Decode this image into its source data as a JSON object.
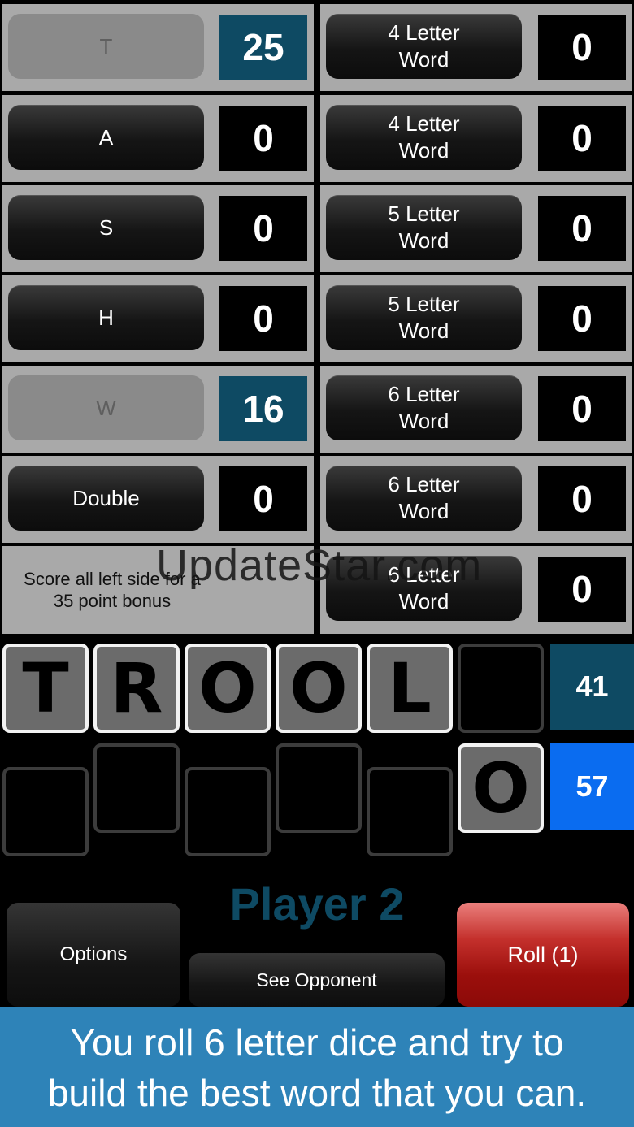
{
  "left_rows": [
    {
      "label": "T",
      "score": "25",
      "used": true
    },
    {
      "label": "A",
      "score": "0",
      "used": false
    },
    {
      "label": "S",
      "score": "0",
      "used": false
    },
    {
      "label": "H",
      "score": "0",
      "used": false
    },
    {
      "label": "W",
      "score": "16",
      "used": true
    },
    {
      "label": "Double",
      "score": "0",
      "used": false
    }
  ],
  "bonus_text": "Score all left side for a\n35 point bonus",
  "right_rows": [
    {
      "label": "4 Letter\nWord",
      "score": "0"
    },
    {
      "label": "4 Letter\nWord",
      "score": "0"
    },
    {
      "label": "5 Letter\nWord",
      "score": "0"
    },
    {
      "label": "5 Letter\nWord",
      "score": "0"
    },
    {
      "label": "6 Letter\nWord",
      "score": "0"
    },
    {
      "label": "6 Letter\nWord",
      "score": "0"
    },
    {
      "label": "6 Letter\nWord",
      "score": "0"
    }
  ],
  "watermark": "UpdateStar.com",
  "word_row": [
    "T",
    "R",
    "O",
    "O",
    "L",
    ""
  ],
  "word_total": "41",
  "dice_row": [
    "",
    "",
    "",
    "",
    "",
    "O"
  ],
  "dice_total": "57",
  "player_label": "Player 2",
  "buttons": {
    "options": "Options",
    "see_opponent": "See Opponent",
    "roll": "Roll (1)"
  },
  "caption": "You roll 6 letter dice and try to\nbuild the best word that you can.",
  "colors": {
    "scored": "#0e4a63",
    "total_active": "#0a6cf0",
    "roll": "#b01512",
    "caption_bg": "#2e83b8"
  }
}
